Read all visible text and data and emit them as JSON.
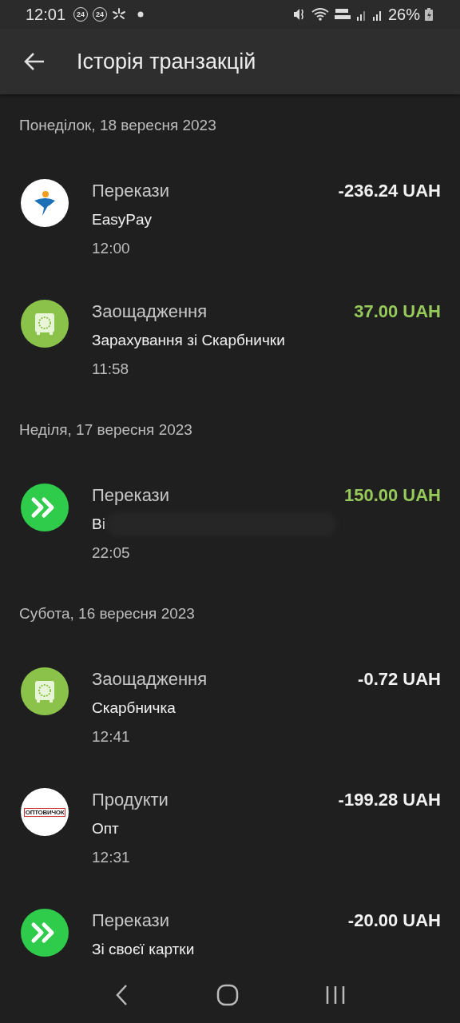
{
  "status_bar": {
    "time": "12:01",
    "badges": [
      "24",
      "24"
    ],
    "battery": "26%"
  },
  "app_bar": {
    "title": "Історія транзакцій"
  },
  "sections": [
    {
      "date": "Понеділок, 18 вересня 2023",
      "transactions": [
        {
          "kind": "easypay",
          "category": "Перекази",
          "amount": "-236.24 UAH",
          "income": false,
          "description": "EasyPay",
          "time": "12:00"
        },
        {
          "kind": "savings",
          "category": "Заощадження",
          "amount": "37.00 UAH",
          "income": true,
          "description": "Зарахування зі Скарбнички",
          "time": "11:58"
        }
      ]
    },
    {
      "date": "Неділя, 17 вересня 2023",
      "transactions": [
        {
          "kind": "transfer",
          "category": "Перекази",
          "amount": "150.00 UAH",
          "income": true,
          "description": "Ві",
          "redacted": true,
          "time": "22:05"
        }
      ]
    },
    {
      "date": "Субота, 16 вересня 2023",
      "transactions": [
        {
          "kind": "savings",
          "category": "Заощадження",
          "amount": "-0.72 UAH",
          "income": false,
          "description": "Скарбничка",
          "time": "12:41"
        },
        {
          "kind": "store",
          "logo_text": "ОПТОВИЧОК",
          "category": "Продукти",
          "amount": "-199.28 UAH",
          "income": false,
          "description": "Опт",
          "time": "12:31"
        },
        {
          "kind": "transfer",
          "category": "Перекази",
          "amount": "-20.00 UAH",
          "income": false,
          "description": "Зі своєї картки"
        }
      ]
    }
  ]
}
